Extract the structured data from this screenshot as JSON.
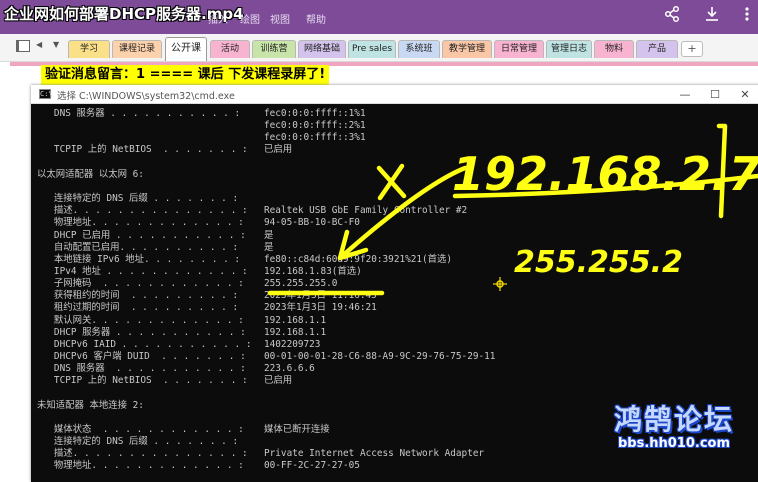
{
  "video_title": "企业网如何部署DHCP服务器.mp4",
  "menu": [
    "插入",
    "绘图",
    "视图",
    "帮助"
  ],
  "ribbon_icons": [
    "share-icon",
    "download-icon",
    "more-icon"
  ],
  "tabs": [
    "学习",
    "课程记录",
    "公开课",
    "活动",
    "训练营",
    "网络基础",
    "Pre sales",
    "系统班",
    "教学管理",
    "日常管理",
    "管理日志",
    "物料",
    "产品"
  ],
  "active_tab": "公开课",
  "add_tab_label": "+",
  "highlight_text": "验证消息留言：1  ==== 课后 下发课程录屏了!",
  "cmd": {
    "title": "选择 C:\\WINDOWS\\system32\\cmd.exe",
    "icon_text": "C:\\",
    "minimize": "—",
    "maximize": "☐",
    "close": "✕",
    "lines": [
      {
        "label": "   DNS 服务器 . . . . . . . . . . . :",
        "value": "fec0:0:0:ffff::1%1"
      },
      {
        "label": "",
        "value": "fec0:0:0:ffff::2%1"
      },
      {
        "label": "",
        "value": "fec0:0:0:ffff::3%1"
      },
      {
        "label": "   TCPIP 上的 NetBIOS  . . . . . . . :",
        "value": "已启用"
      },
      {
        "label": "",
        "value": ""
      },
      {
        "label": "以太网适配器 以太网 6:",
        "value": ""
      },
      {
        "label": "",
        "value": ""
      },
      {
        "label": "   连接特定的 DNS 后缀 . . . . . . . :",
        "value": ""
      },
      {
        "label": "   描述. . . . . . . . . . . . . . . :",
        "value": "Realtek USB GbE Family Controller #2"
      },
      {
        "label": "   物理地址. . . . . . . . . . . . . :",
        "value": "94-05-BB-10-BC-F0"
      },
      {
        "label": "   DHCP 已启用 . . . . . . . . . . . :",
        "value": "是"
      },
      {
        "label": "   自动配置已启用. . . . . . . . . . :",
        "value": "是"
      },
      {
        "label": "   本地链接 IPv6 地址. . . . . . . . :",
        "value": "fe80::c84d:60a9:9f20:3921%21(首选)"
      },
      {
        "label": "   IPv4 地址 . . . . . . . . . . . . :",
        "value": "192.168.1.83(首选)"
      },
      {
        "label": "   子网掩码  . . . . . . . . . . . . :",
        "value": "255.255.255.0"
      },
      {
        "label": "   获得租约的时间  . . . . . . . . . :",
        "value": "2023年1月3日 11:16:45"
      },
      {
        "label": "   租约过期的时间  . . . . . . . . . :",
        "value": "2023年1月3日 19:46:21"
      },
      {
        "label": "   默认网关. . . . . . . . . . . . . :",
        "value": "192.168.1.1"
      },
      {
        "label": "   DHCP 服务器 . . . . . . . . . . . :",
        "value": "192.168.1.1"
      },
      {
        "label": "   DHCPv6 IAID . . . . . . . . . . . :",
        "value": "1402209723"
      },
      {
        "label": "   DHCPv6 客户端 DUID  . . . . . . . :",
        "value": "00-01-00-01-28-C6-88-A9-9C-29-76-75-29-11"
      },
      {
        "label": "   DNS 服务器  . . . . . . . . . . . :",
        "value": "223.6.6.6"
      },
      {
        "label": "   TCPIP 上的 NetBIOS  . . . . . . . :",
        "value": "已启用"
      },
      {
        "label": "",
        "value": ""
      },
      {
        "label": "未知适配器 本地连接 2:",
        "value": ""
      },
      {
        "label": "",
        "value": ""
      },
      {
        "label": "   媒体状态  . . . . . . . . . . . . :",
        "value": "媒体已断开连接"
      },
      {
        "label": "   连接特定的 DNS 后缀 . . . . . . . :",
        "value": ""
      },
      {
        "label": "   描述. . . . . . . . . . . . . . . :",
        "value": "Private Internet Access Network Adapter"
      },
      {
        "label": "   物理地址. . . . . . . . . . . . . :",
        "value": "00-FF-2C-27-27-05"
      }
    ]
  },
  "ink_annotations": {
    "ip": "192.168.2.7",
    "mask": "255.255.2"
  },
  "watermark": {
    "brand": "鸿鹄论坛",
    "url": "bbs.hh010.com"
  },
  "colors": {
    "ribbon": "#7d4b98",
    "highlight": "#ffff00",
    "console_bg": "#0c0c0c",
    "console_text": "#c8c8c8",
    "ink": "#ffff14",
    "active_tab_bg": "#ffffff"
  }
}
